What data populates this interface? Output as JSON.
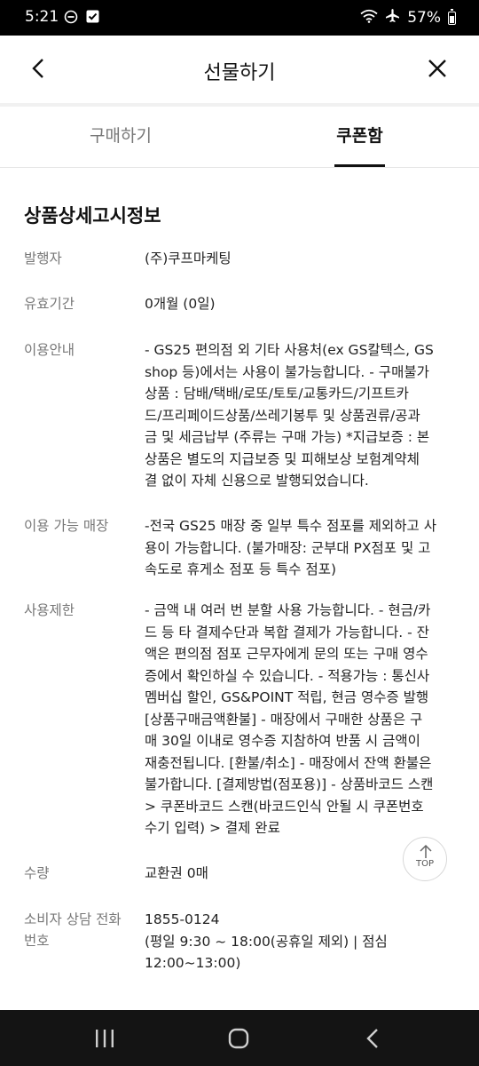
{
  "status_bar": {
    "time": "5:21",
    "battery": "57%",
    "icons": [
      "do-not-disturb-icon",
      "checkbox-notification-icon",
      "wifi-icon",
      "airplane-icon",
      "battery-icon"
    ]
  },
  "header": {
    "title": "선물하기",
    "back_icon": "chevron-left-icon",
    "close_icon": "close-icon"
  },
  "tabs": [
    {
      "label": "구매하기",
      "active": false
    },
    {
      "label": "쿠폰함",
      "active": true
    }
  ],
  "section_title": "상품상세고시정보",
  "details": [
    {
      "label": "발행자",
      "lines": [
        "(주)쿠프마케팅"
      ]
    },
    {
      "label": "유효기간",
      "lines": [
        "0개월 (0일)"
      ]
    },
    {
      "label": "이용안내",
      "lines": [
        "- GS25 편의점 외 기타 사용처(ex GS칼텍스, GS",
        "shop 등)에서는 사용이 불가능합니다. - 구매불가",
        "상품 : 담배/택배/로또/토토/교통카드/기프트카",
        "드/프리페이드상품/쓰레기봉투 및 상품권류/공과",
        "금 및 세금납부 (주류는 구매 가능) *지급보증 : 본",
        "상품은 별도의 지급보증 및 피해보상 보험계약체",
        "결 없이 자체 신용으로 발행되었습니다."
      ]
    },
    {
      "label": "이용 가능 매장",
      "lines": [
        "-전국 GS25 매장 중 일부 특수 점포를 제외하고 사",
        "용이 가능합니다. (불가매장: 군부대 PX점포 및 고",
        "속도로 휴게소 점포 등 특수 점포)"
      ]
    },
    {
      "label": "사용제한",
      "lines": [
        "- 금액 내 여러 번 분할 사용 가능합니다. - 현금/카",
        "드 등 타 결제수단과 복합 결제가 가능합니다. - 잔",
        "액은 편의점 점포 근무자에게 문의 또는 구매 영수",
        "증에서 확인하실 수 있습니다. - 적용가능 : 통신사",
        "멤버십 할인, GS&POINT 적립, 현금 영수증 발행",
        "[상품구매금액환불] - 매장에서 구매한 상품은 구",
        "매 30일 이내로 영수증 지참하여 반품 시 금액이",
        "재충전됩니다. [환불/취소] - 매장에서 잔액 환불은",
        "불가합니다. [결제방법(점포용)] - 상품바코드 스캔",
        "> 쿠폰바코드 스캔(바코드인식 안될 시 쿠폰번호",
        "수기 입력) > 결제 완료"
      ]
    },
    {
      "label": "수량",
      "lines": [
        "교환권 0매"
      ]
    },
    {
      "label_lines": [
        "소비자 상담 전화",
        "번호"
      ],
      "lines": [
        "1855-0124",
        "(평일 9:30 ~ 18:00(공휴일 제외) | 점심",
        "12:00~13:00)"
      ]
    }
  ],
  "top_button": {
    "label": "TOP",
    "icon": "arrow-up-icon"
  },
  "nav_bar": {
    "icons": [
      "recent-apps-icon",
      "home-icon",
      "back-icon"
    ]
  }
}
